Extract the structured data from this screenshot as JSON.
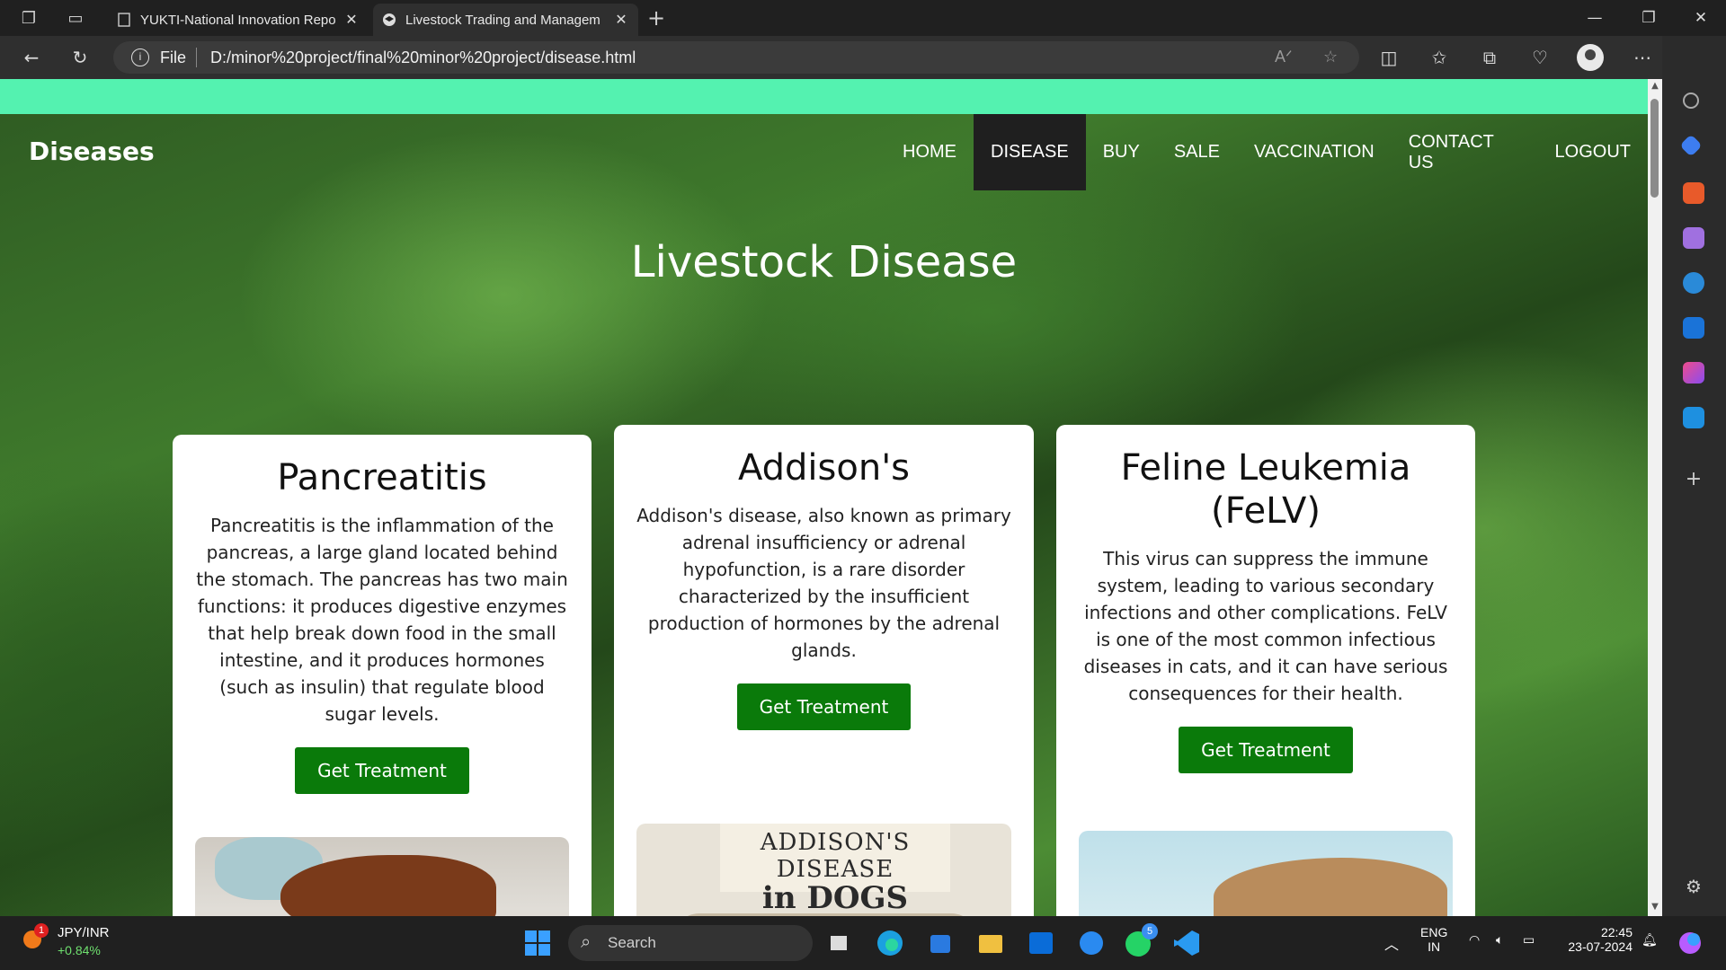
{
  "browser": {
    "tabs": [
      {
        "title": "YUKTI-National Innovation Repo",
        "active": false
      },
      {
        "title": "Livestock Trading and Managem",
        "active": true
      }
    ],
    "address": {
      "scheme": "File",
      "url": "D:/minor%20project/final%20minor%20project/disease.html"
    }
  },
  "site": {
    "brand": "Diseases",
    "nav": [
      "HOME",
      "DISEASE",
      "BUY",
      "SALE",
      "VACCINATION",
      "CONTACT US",
      "LOGOUT"
    ],
    "active_nav": "DISEASE",
    "hero_title": "Livestock Disease",
    "cards": [
      {
        "title": "Pancreatitis",
        "body": "Pancreatitis is the inflammation of the pancreas, a large gland located behind the stomach. The pancreas has two main functions: it produces digestive enzymes that help break down food in the small intestine, and it produces hormones (such as insulin) that regulate blood sugar levels.",
        "button": "Get Treatment"
      },
      {
        "title": "Addison's",
        "body": "Addison's disease, also known as primary adrenal insufficiency or adrenal hypofunction, is a rare disorder characterized by the insufficient production of hormones by the adrenal glands.",
        "button": "Get Treatment",
        "image_text": [
          "ADDISON'S DISEASE",
          "in DOGS"
        ]
      },
      {
        "title": "Feline Leukemia (FeLV)",
        "body": "This virus can suppress the immune system, leading to various secondary infections and other complications. FeLV is one of the most common infectious diseases in cats, and it can have serious consequences for their health.",
        "button": "Get Treatment"
      }
    ],
    "colors": {
      "top_bar": "#54f2b0",
      "button": "#0a7a0a",
      "active_nav_bg": "#1f1f1f"
    }
  },
  "taskbar": {
    "ticker_symbol": "JPY/INR",
    "ticker_change": "+0.84%",
    "ticker_badge": "1",
    "search_placeholder": "Search",
    "whatsapp_badge": "5",
    "lang_line1": "ENG",
    "lang_line2": "IN",
    "time": "22:45",
    "date": "23-07-2024"
  }
}
